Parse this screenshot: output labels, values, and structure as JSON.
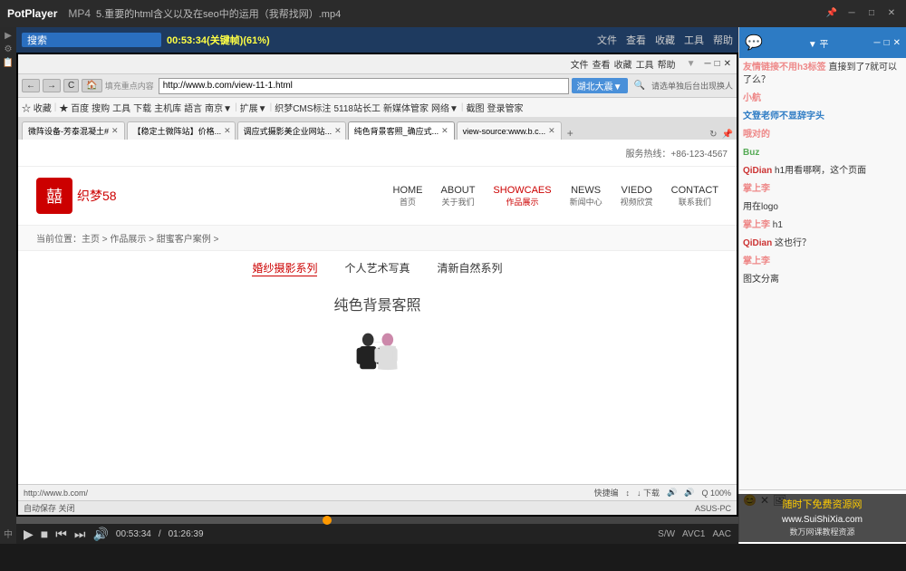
{
  "titleBar": {
    "appName": "PotPlayer",
    "format": "MP4",
    "videoTitle": "5.重要的html含义以及在seo中的运用（我帮找网）.mp4",
    "winControls": [
      "─",
      "□",
      "✕"
    ]
  },
  "videoToolbar": {
    "searchLabel": "搜索",
    "timeDisplay": "00:53:34(关键帧)(61%)",
    "menuItems": [
      "文件",
      "查看",
      "收藏",
      "工具",
      "帮助"
    ]
  },
  "browser": {
    "topbarItems": [
      "文件",
      "查看",
      "收藏",
      "工具",
      "帮助",
      "—",
      "□",
      "✕"
    ],
    "navButtons": [
      "←",
      "→",
      "C",
      "🏠"
    ],
    "addressBarLabel": "填充重点内容",
    "addressUrl": "http://www.b.com/view-11-1.html",
    "goButton": "湖北大震▼",
    "searchPlaceholder": "请选单独后台出现换人",
    "bookmarks": [
      "☆ 收藏",
      "★ 百度",
      "搜购",
      "工具",
      "下载",
      "主机库",
      "語言",
      "南京▼",
      "扩展▼",
      "织梦CMS标注",
      "5118站长工",
      "新媒体管家",
      "网络▼",
      "截图",
      "登录管家"
    ],
    "tabs": [
      {
        "label": "微阵设备-芳泰混凝土#",
        "active": false
      },
      {
        "label": "【稳定土微阵站】价格...",
        "active": false
      },
      {
        "label": "调应式摄影美企业网站...",
        "active": false
      },
      {
        "label": "纯色背景客照_确应式...",
        "active": true
      },
      {
        "label": "view-source:www.b.c...",
        "active": false
      }
    ],
    "statusUrl": "http://www.b.com/",
    "statusRight": [
      "快捷编",
      "↕",
      "↓下载",
      "🔊",
      "🔊",
      "Q 100%"
    ]
  },
  "website": {
    "hotline": "服务热线：+86-123-4567",
    "logo": "囍",
    "logoText": "织梦58",
    "menu": [
      {
        "en": "HOME",
        "cn": "首页",
        "active": false
      },
      {
        "en": "ABOUT",
        "cn": "关于我们",
        "active": false
      },
      {
        "en": "SHOWCAES",
        "cn": "作品展示",
        "active": true
      },
      {
        "en": "NEWS",
        "cn": "新闻中心",
        "active": false
      },
      {
        "en": "VIEDO",
        "cn": "视频欣赏",
        "active": false
      },
      {
        "en": "CONTACT",
        "cn": "联系我们",
        "active": false
      }
    ],
    "breadcrumb": "当前位置：主页 > 作品展示 > 甜蜜客户案例 >",
    "subNav": [
      {
        "label": "婚纱摄影系列",
        "active": true
      },
      {
        "label": "个人艺术写真",
        "active": false
      },
      {
        "label": "清新自然系列",
        "active": false
      }
    ],
    "mainTitle": "纯色背景客照"
  },
  "chatPanel": {
    "title": "▼  平",
    "messages": [
      {
        "user": "友情链接不用h3标签",
        "userColor": "orange",
        "text": "直接到了7就可以了么？"
      },
      {
        "user": "小航",
        "userColor": "orange",
        "text": ""
      },
      {
        "user": "文登老师不显辞字头",
        "userColor": "",
        "text": ""
      },
      {
        "user": "哦对的",
        "userColor": "orange",
        "text": ""
      },
      {
        "user": "Buz",
        "userColor": "green",
        "text": ""
      },
      {
        "user": "QiDian",
        "userColor": "red",
        "text": "h1用看哪啊，这个页面"
      },
      {
        "user": "掌上李",
        "userColor": "orange",
        "text": ""
      },
      {
        "user": "用在logo",
        "userColor": "",
        "text": ""
      },
      {
        "user": "掌上李",
        "userColor": "orange",
        "text": "h1"
      },
      {
        "user": "QiDian",
        "userColor": "red",
        "text": "这也行？"
      },
      {
        "user": "掌上李",
        "userColor": "orange",
        "text": ""
      },
      {
        "user": "图文分离",
        "userColor": "",
        "text": ""
      }
    ],
    "toolIcons": [
      "😊",
      "✕",
      "🖼"
    ]
  },
  "playbackControls": {
    "playBtn": "▶",
    "stopBtn": "■",
    "prevBtn": "⏮",
    "nextBtn": "⏭",
    "speakerBtn": "🔊",
    "currentTime": "00:53:34",
    "totalTime": "01:26:39",
    "format1": "S/W",
    "format2": "AVC1",
    "format3": "AAC",
    "progress": 43
  },
  "watermark": {
    "tagline": "随时下免费资源网",
    "url": "www.SuiShiXia.com",
    "sub": "数万网课教程资源"
  }
}
